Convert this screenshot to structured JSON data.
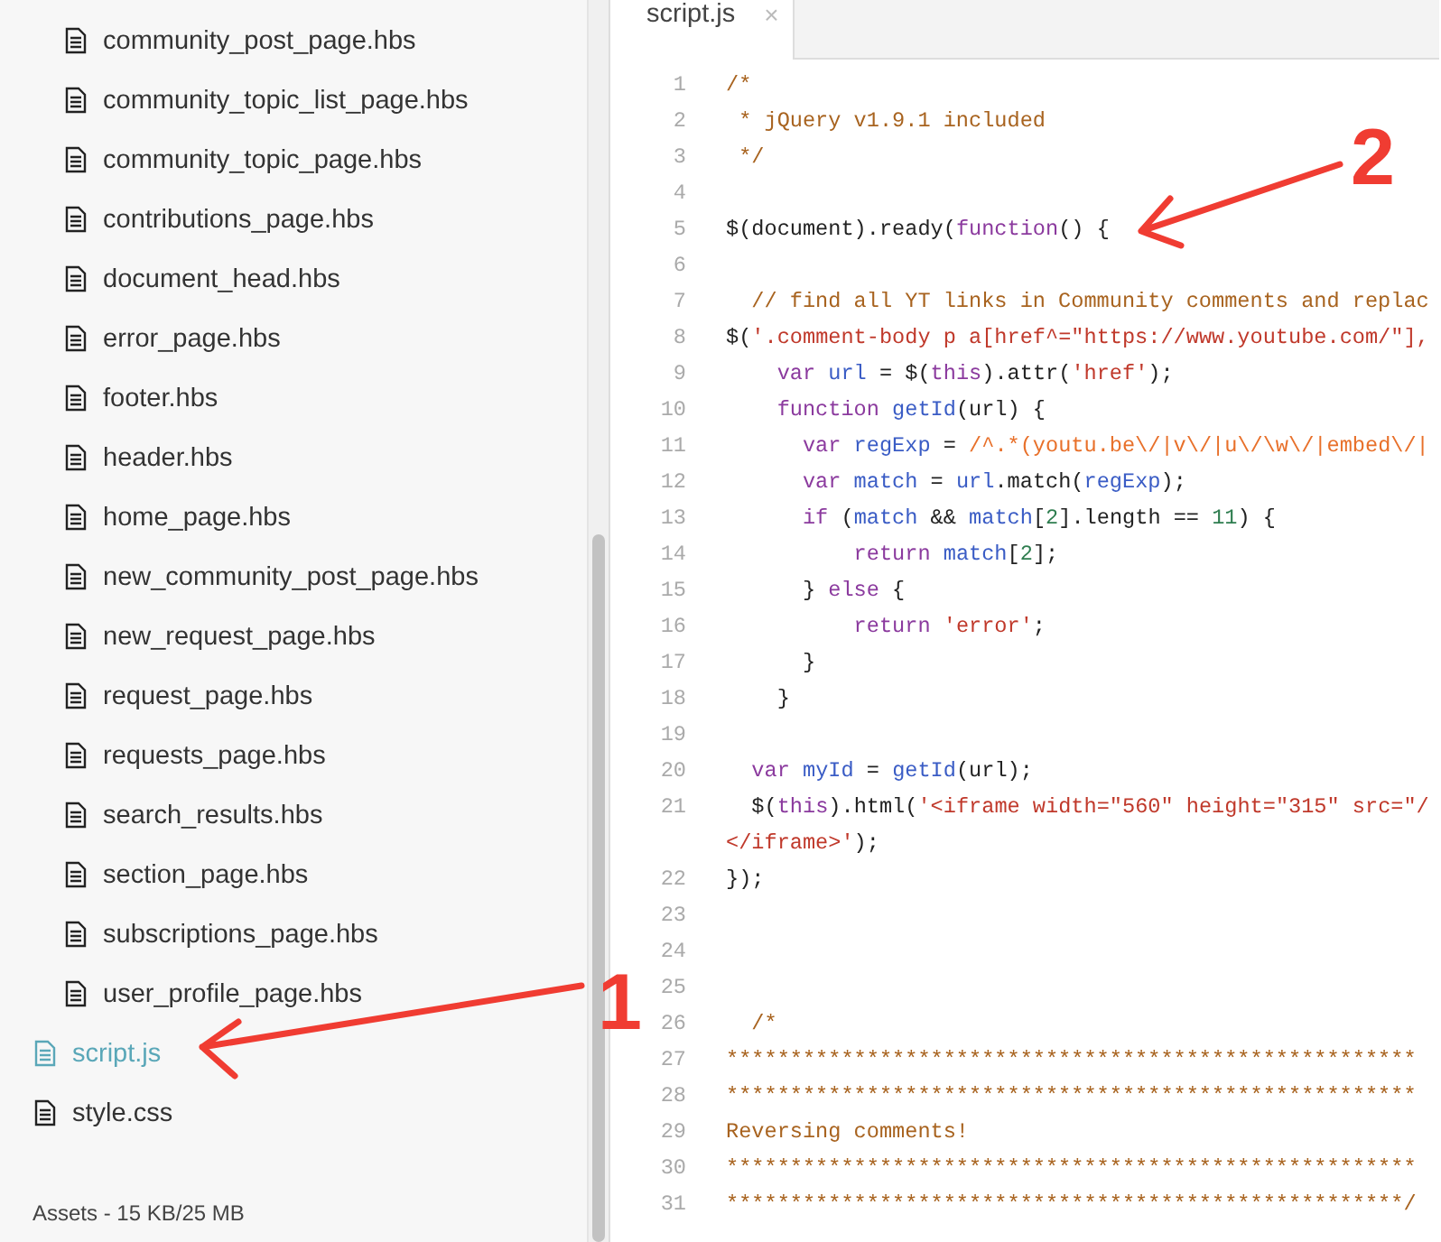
{
  "sidebar": {
    "folder_files": [
      {
        "label": "community_post_page.hbs",
        "selected": false
      },
      {
        "label": "community_topic_list_page.hbs",
        "selected": false
      },
      {
        "label": "community_topic_page.hbs",
        "selected": false
      },
      {
        "label": "contributions_page.hbs",
        "selected": false
      },
      {
        "label": "document_head.hbs",
        "selected": false
      },
      {
        "label": "error_page.hbs",
        "selected": false
      },
      {
        "label": "footer.hbs",
        "selected": false
      },
      {
        "label": "header.hbs",
        "selected": false
      },
      {
        "label": "home_page.hbs",
        "selected": false
      },
      {
        "label": "new_community_post_page.hbs",
        "selected": false
      },
      {
        "label": "new_request_page.hbs",
        "selected": false
      },
      {
        "label": "request_page.hbs",
        "selected": false
      },
      {
        "label": "requests_page.hbs",
        "selected": false
      },
      {
        "label": "search_results.hbs",
        "selected": false
      },
      {
        "label": "section_page.hbs",
        "selected": false
      },
      {
        "label": "subscriptions_page.hbs",
        "selected": false
      },
      {
        "label": "user_profile_page.hbs",
        "selected": false
      }
    ],
    "root_files": [
      {
        "label": "script.js",
        "selected": true
      },
      {
        "label": "style.css",
        "selected": false
      }
    ],
    "footer": "Assets - 15 KB/25 MB"
  },
  "editor": {
    "tabs": [
      {
        "label": "script.js",
        "close": "×",
        "selected": true
      }
    ],
    "lines": [
      {
        "number": "1",
        "tokens": [
          {
            "kind": "comment",
            "text": "/*"
          }
        ]
      },
      {
        "number": "2",
        "tokens": [
          {
            "kind": "comment",
            "text": " * jQuery v1.9.1 included"
          }
        ]
      },
      {
        "number": "3",
        "tokens": [
          {
            "kind": "comment",
            "text": " */"
          }
        ]
      },
      {
        "number": "4"
      },
      {
        "number": "5",
        "tokens": [
          {
            "kind": "plain",
            "text": "$(document).ready("
          },
          {
            "kind": "keyword",
            "text": "function"
          },
          {
            "kind": "plain",
            "text": "() {"
          }
        ]
      },
      {
        "number": "6"
      },
      {
        "number": "7",
        "tokens": [
          {
            "kind": "comment",
            "text": "  // find all YT links in Community comments and replac"
          }
        ]
      },
      {
        "number": "8",
        "tokens": [
          {
            "kind": "plain",
            "text": "$("
          },
          {
            "kind": "string",
            "text": "'.comment-body p a[href^=\"https://www.youtube.com/\"],"
          }
        ]
      },
      {
        "number": "9",
        "tokens": [
          {
            "kind": "keyword",
            "text": "    var"
          },
          {
            "kind": "variable",
            "text": " url"
          },
          {
            "kind": "plain",
            "text": " = $("
          },
          {
            "kind": "keyword",
            "text": "this"
          },
          {
            "kind": "plain",
            "text": ").attr("
          },
          {
            "kind": "string",
            "text": "'href'"
          },
          {
            "kind": "plain",
            "text": ");"
          }
        ]
      },
      {
        "number": "10",
        "tokens": [
          {
            "kind": "keyword",
            "text": "    function"
          },
          {
            "kind": "variable",
            "text": " getId"
          },
          {
            "kind": "plain",
            "text": "(url) {"
          }
        ]
      },
      {
        "number": "11",
        "tokens": [
          {
            "kind": "keyword",
            "text": "      var"
          },
          {
            "kind": "variable",
            "text": " regExp"
          },
          {
            "kind": "plain",
            "text": " = "
          },
          {
            "kind": "regex",
            "text": "/^.*(youtu.be\\/|v\\/|u\\/\\w\\/|embed\\/|"
          }
        ]
      },
      {
        "number": "12",
        "tokens": [
          {
            "kind": "keyword",
            "text": "      var"
          },
          {
            "kind": "variable",
            "text": " match"
          },
          {
            "kind": "plain",
            "text": " = "
          },
          {
            "kind": "variable",
            "text": "url"
          },
          {
            "kind": "plain",
            "text": ".match("
          },
          {
            "kind": "variable",
            "text": "regExp"
          },
          {
            "kind": "plain",
            "text": ");"
          }
        ]
      },
      {
        "number": "13",
        "tokens": [
          {
            "kind": "keyword",
            "text": "      if"
          },
          {
            "kind": "plain",
            "text": " ("
          },
          {
            "kind": "variable",
            "text": "match"
          },
          {
            "kind": "plain",
            "text": " && "
          },
          {
            "kind": "variable",
            "text": "match"
          },
          {
            "kind": "plain",
            "text": "["
          },
          {
            "kind": "number",
            "text": "2"
          },
          {
            "kind": "plain",
            "text": "].length == "
          },
          {
            "kind": "number",
            "text": "11"
          },
          {
            "kind": "plain",
            "text": ") {"
          }
        ]
      },
      {
        "number": "14",
        "tokens": [
          {
            "kind": "keyword",
            "text": "          return"
          },
          {
            "kind": "variable",
            "text": " match"
          },
          {
            "kind": "plain",
            "text": "["
          },
          {
            "kind": "number",
            "text": "2"
          },
          {
            "kind": "plain",
            "text": "];"
          }
        ]
      },
      {
        "number": "15",
        "tokens": [
          {
            "kind": "plain",
            "text": "      } "
          },
          {
            "kind": "keyword",
            "text": "else"
          },
          {
            "kind": "plain",
            "text": " {"
          }
        ]
      },
      {
        "number": "16",
        "tokens": [
          {
            "kind": "keyword",
            "text": "          return"
          },
          {
            "kind": "string",
            "text": " 'error'"
          },
          {
            "kind": "plain",
            "text": ";"
          }
        ]
      },
      {
        "number": "17",
        "tokens": [
          {
            "kind": "plain",
            "text": "      }"
          }
        ]
      },
      {
        "number": "18",
        "tokens": [
          {
            "kind": "plain",
            "text": "    }"
          }
        ]
      },
      {
        "number": "19"
      },
      {
        "number": "20",
        "tokens": [
          {
            "kind": "keyword",
            "text": "  var"
          },
          {
            "kind": "variable",
            "text": " myId"
          },
          {
            "kind": "plain",
            "text": " = "
          },
          {
            "kind": "variable",
            "text": "getId"
          },
          {
            "kind": "plain",
            "text": "(url);"
          }
        ]
      },
      {
        "number": "21",
        "tokens": [
          {
            "kind": "plain",
            "text": "  $("
          },
          {
            "kind": "keyword",
            "text": "this"
          },
          {
            "kind": "plain",
            "text": ").html("
          },
          {
            "kind": "string",
            "text": "'<iframe width=\"560\" height=\"315\" src=\"/"
          }
        ]
      },
      {
        "tokens": [
          {
            "kind": "string",
            "text": "</iframe>'"
          },
          {
            "kind": "plain",
            "text": ");"
          }
        ]
      },
      {
        "number": "22",
        "tokens": [
          {
            "kind": "plain",
            "text": "});"
          }
        ]
      },
      {
        "number": "23"
      },
      {
        "number": "24"
      },
      {
        "number": "25"
      },
      {
        "number": "26",
        "tokens": [
          {
            "kind": "comment",
            "text": "  /*"
          }
        ]
      },
      {
        "number": "27",
        "tokens": [
          {
            "kind": "comment",
            "text": "******************************************************"
          }
        ]
      },
      {
        "number": "28",
        "tokens": [
          {
            "kind": "comment",
            "text": "******************************************************"
          }
        ]
      },
      {
        "number": "29",
        "tokens": [
          {
            "kind": "comment",
            "text": "Reversing comments!"
          }
        ]
      },
      {
        "number": "30",
        "tokens": [
          {
            "kind": "comment",
            "text": "******************************************************"
          }
        ]
      },
      {
        "number": "31",
        "tokens": [
          {
            "kind": "comment",
            "text": "*****************************************************/"
          }
        ]
      }
    ]
  },
  "annotations": [
    {
      "label": "1"
    },
    {
      "label": "2"
    }
  ]
}
